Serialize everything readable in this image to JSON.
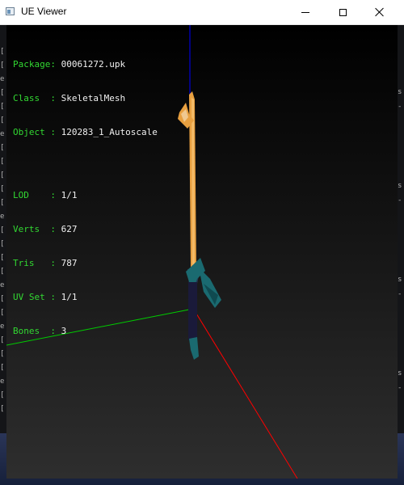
{
  "window": {
    "title": "UE Viewer",
    "controls": {
      "minimize": "minimize-icon",
      "maximize": "maximize-icon",
      "close": "close-icon"
    }
  },
  "background": {
    "left_marks": [
      "[",
      "[",
      "e",
      "[",
      "[",
      "[",
      "e",
      "[",
      "[",
      "[",
      "[",
      "[",
      "e",
      "[",
      "[",
      "[",
      "[",
      "e",
      "[",
      "[",
      "e",
      "[",
      "[",
      "[",
      "e",
      "[",
      "["
    ],
    "right_marks": [
      "s",
      "-",
      "s",
      "-",
      "s",
      "-",
      "s",
      "-"
    ]
  },
  "info": {
    "package_key": "Package:",
    "package_value": "00061272.upk",
    "class_key": "Class  :",
    "class_value": "SkeletalMesh",
    "object_key": "Object :",
    "object_value": "120283_1_Autoscale",
    "lod_key": "LOD    :",
    "lod_value": "1/1",
    "verts_key": "Verts  :",
    "verts_value": "627",
    "tris_key": "Tris   :",
    "tris_value": "787",
    "uvset_key": "UV Set :",
    "uvset_value": "1/1",
    "bones_key": "Bones  :",
    "bones_value": "3"
  },
  "colors": {
    "info_key": "#32d832",
    "info_value": "#f0f0f0",
    "axis_x": "#ff0000",
    "axis_y": "#00cc00",
    "axis_z": "#0000ff",
    "blade": "#e8a040",
    "handle": "#1a1a3a",
    "ribbon": "#1a6a70"
  }
}
